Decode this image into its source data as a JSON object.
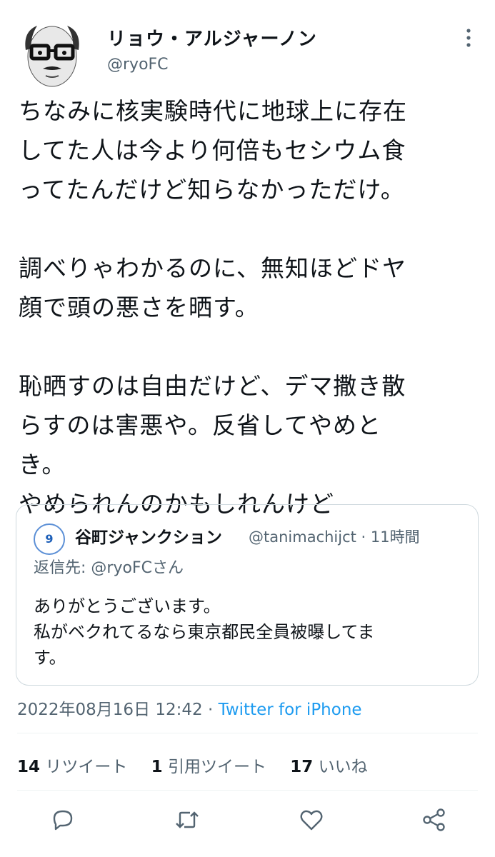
{
  "author": {
    "display_name": "リョウ・アルジャーノン",
    "handle": "@ryoFC"
  },
  "tweet": {
    "text": "ちなみに核実験時代に地球上に存在\nしてた人は今より何倍もセシウム食\nってたんだけど知らなかっただけ。\n\n調べりゃわかるのに、無知ほどドヤ\n顔で頭の悪さを晒す。\n\n恥晒すのは自由だけど、デマ撒き散\nらすのは害悪や。反省してやめと\nき。\nやめられんのかもしれんけど"
  },
  "quote": {
    "avatar_label": "9",
    "name": "谷町ジャンクション",
    "meta": "@tanimachijct · 11時間",
    "reply_prefix": "返信先: ",
    "reply_handle": "@ryoFCさん",
    "text": "ありがとうございます。\n私がベクれてるなら東京都民全員被曝してま\nす。"
  },
  "timestamp": "2022年08月16日 12:42 · ",
  "source": "Twitter for iPhone",
  "stats": {
    "retweets_count": "14",
    "retweets_label": "リツイート",
    "quotes_count": "1",
    "quotes_label": "引用ツイート",
    "likes_count": "17",
    "likes_label": "いいね"
  },
  "colors": {
    "text": "#0f1419",
    "secondary": "#536471",
    "link": "#1d9bf0",
    "border": "#cfd9de"
  },
  "icons": [
    "more-icon",
    "reply-icon",
    "retweet-icon",
    "like-icon",
    "share-icon"
  ]
}
